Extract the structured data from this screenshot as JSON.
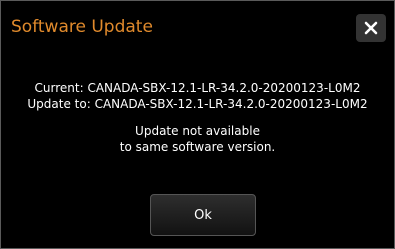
{
  "dialog": {
    "title": "Software Update",
    "close_icon": "close-icon",
    "current_line": "Current: CANADA-SBX-12.1-LR-34.2.0-20200123-L0M2",
    "update_to_line": "Update to: CANADA-SBX-12.1-LR-34.2.0-20200123-L0M2",
    "message_line1": "Update not available",
    "message_line2": "to same software version.",
    "ok_label": "Ok"
  },
  "colors": {
    "title": "#e08a2c",
    "background": "#000000",
    "text": "#ffffff"
  }
}
